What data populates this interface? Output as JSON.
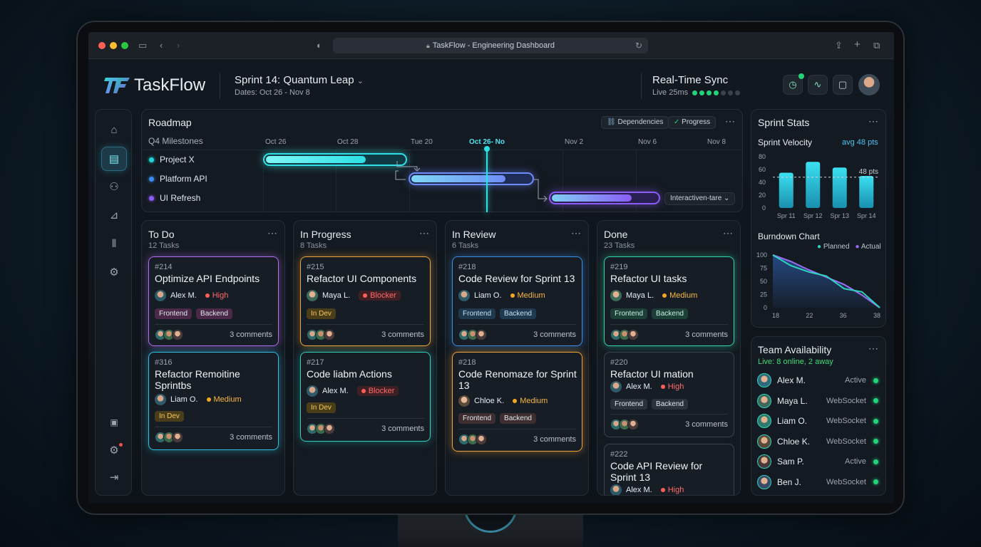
{
  "browser": {
    "url_title": "TaskFlow - Engineering Dashboard"
  },
  "app": {
    "name": "TaskFlow",
    "sprint_title": "Sprint 14: Quantum Leap",
    "sprint_dates": "Dates: Oct 26 - Nov 8",
    "sync_title": "Real-Time Sync",
    "sync_sub": "Live 25ms"
  },
  "sidebar": {
    "top_icons": [
      "home-icon",
      "board-icon",
      "team-icon",
      "analytics-icon",
      "pipeline-icon",
      "settings-icon"
    ],
    "bottom_icons": [
      "help-icon",
      "preferences-icon",
      "logout-icon"
    ]
  },
  "roadmap": {
    "title": "Roadmap",
    "subtitle": "Q4 Milestones",
    "dependencies_label": "Dependencies",
    "progress_label": "Progress",
    "ticks": [
      "Oct 26",
      "Oct 28",
      "Tue 20",
      "Oct 26- No",
      "Nov 2",
      "Nov 6",
      "Nov 8"
    ],
    "items": [
      {
        "label": "Project X",
        "color": "#22d3d9"
      },
      {
        "label": "Platform API",
        "color": "#3b8bf0"
      },
      {
        "label": "UI Refresh",
        "color": "#8b5cf6"
      }
    ],
    "dropdown_label": "Interactiven-tare"
  },
  "columns": [
    {
      "title": "To Do",
      "count": "12 Tasks",
      "cards": [
        {
          "num": "#214",
          "title": "Optimize API Endpoints",
          "assignee": "Alex M.",
          "priority": "High",
          "tags": [
            "Frontend",
            "Backend"
          ],
          "comments": "3 comments"
        },
        {
          "num": "#316",
          "title": "Refactor Remoitine Sprintbs",
          "assignee": "Liam O.",
          "priority": "Medium",
          "tags": [
            "In Dev"
          ],
          "comments": "3 comments"
        }
      ]
    },
    {
      "title": "In Progress",
      "count": "8 Tasks",
      "cards": [
        {
          "num": "#215",
          "title": "Refactor UI Components",
          "assignee": "Maya L.",
          "priority": "Blocker",
          "tags": [
            "In Dev"
          ],
          "comments": "3 comments"
        },
        {
          "num": "#217",
          "title": "Code liabm Actions",
          "assignee": "Alex M.",
          "priority": "Blocker",
          "tags": [
            "In Dev"
          ],
          "comments": "3 comments"
        }
      ]
    },
    {
      "title": "In Review",
      "count": "6 Tasks",
      "cards": [
        {
          "num": "#218",
          "title": "Code Review for Sprint 13",
          "assignee": "Liam O.",
          "priority": "Medium",
          "tags": [
            "Frontend",
            "Backend"
          ],
          "comments": "3 comments"
        },
        {
          "num": "#218",
          "title": "Code Renomaze for Sprint 13",
          "assignee": "Chloe K.",
          "priority": "Medium",
          "tags": [
            "Frontend",
            "Backend"
          ],
          "comments": "3 comments"
        }
      ]
    },
    {
      "title": "Done",
      "count": "23 Tasks",
      "cards": [
        {
          "num": "#219",
          "title": "Refactor UI tasks",
          "assignee": "Maya L.",
          "priority": "Medium",
          "tags": [
            "Frontend",
            "Backend"
          ],
          "comments": "3 comments"
        },
        {
          "num": "#220",
          "title": "Refactor UI mation",
          "assignee": "Alex M.",
          "priority": "High",
          "tags": [
            "Frontend",
            "Backend"
          ],
          "comments": "3 comments"
        },
        {
          "num": "#222",
          "title": "Code API Review for Sprint 13",
          "assignee": "Alex M.",
          "priority": "High",
          "tags": [],
          "comments": ""
        }
      ]
    }
  ],
  "stats": {
    "title": "Sprint Stats",
    "velocity_label": "Sprint Velocity",
    "velocity_avg": "avg 48 pts",
    "avg_line_label": "48 pts",
    "burndown_label": "Burndown Chart",
    "legend_planned": "Planned",
    "legend_actual": "Actual"
  },
  "chart_data": [
    {
      "type": "bar",
      "title": "Sprint Velocity",
      "categories": [
        "Spr 11",
        "Spr 12",
        "Spr 13",
        "Spr 14"
      ],
      "values": [
        55,
        72,
        63,
        50
      ],
      "ylim": [
        0,
        80
      ],
      "yticks": [
        "80",
        "60",
        "40",
        "20",
        "0"
      ],
      "reference_line": 48
    },
    {
      "type": "line",
      "title": "Burndown Chart",
      "x": [
        18,
        22,
        36,
        38
      ],
      "xticks": [
        "18",
        "22",
        "36",
        "38"
      ],
      "yticks": [
        "100",
        "75",
        "50",
        "25",
        "0"
      ],
      "ylim": [
        0,
        100
      ],
      "series": [
        {
          "name": "Planned",
          "color": "#9b6df5",
          "values": [
            100,
            88,
            72,
            58,
            44,
            24,
            0
          ]
        },
        {
          "name": "Actual",
          "color": "#2dd4bf",
          "values": [
            100,
            80,
            68,
            60,
            36,
            30,
            0
          ]
        }
      ]
    }
  ],
  "team": {
    "title": "Team Availability",
    "live": "Live: 8 online, 2 away",
    "members": [
      {
        "name": "Alex M.",
        "status": "Active"
      },
      {
        "name": "Maya L.",
        "status": "WebSocket"
      },
      {
        "name": "Liam O.",
        "status": "WebSocket"
      },
      {
        "name": "Chloe K.",
        "status": "WebSocket"
      },
      {
        "name": "Sam P.",
        "status": "Active"
      },
      {
        "name": "Ben J.",
        "status": "WebSocket"
      }
    ]
  }
}
